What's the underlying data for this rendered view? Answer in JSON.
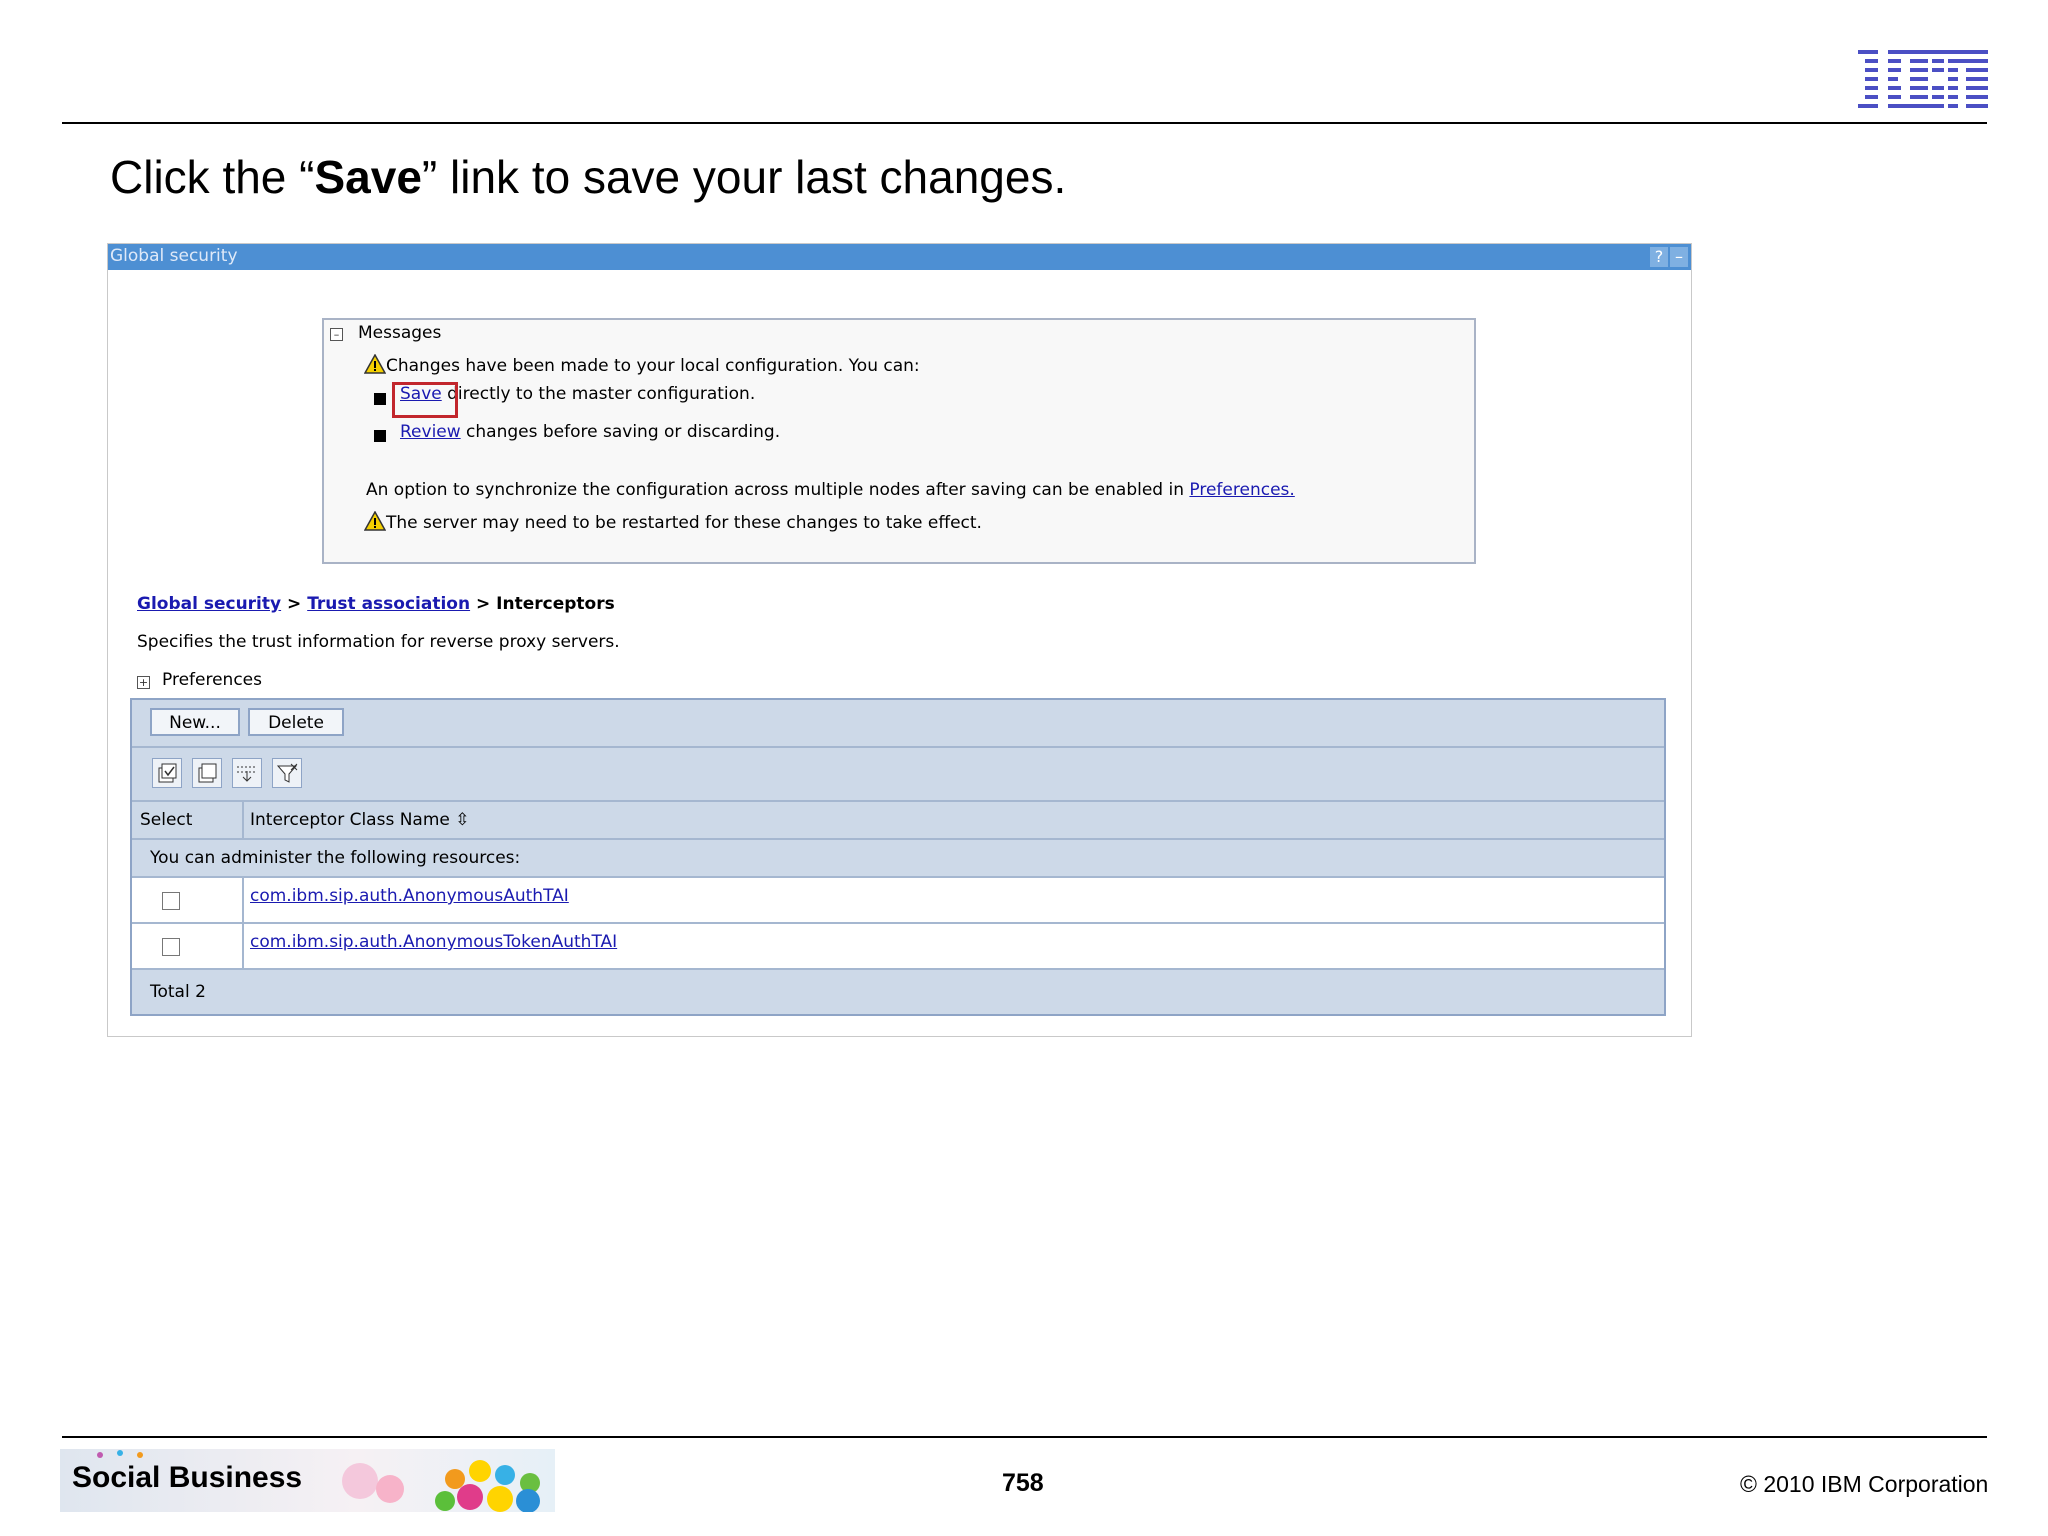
{
  "slide": {
    "title_prefix": "Click the “",
    "title_bold": "Save",
    "title_suffix": "” link to save your last changes.",
    "logo_text": "IBM"
  },
  "window": {
    "title": "Global security",
    "help_icon": "?",
    "minimize_icon": "–"
  },
  "messages": {
    "header": "Messages",
    "changes_note": "Changes have been made to your local configuration. You can:",
    "save_link": "Save",
    "save_rest": " directly to the master configuration.",
    "review_link": "Review",
    "review_rest": " changes before saving or discarding.",
    "sync_note": "An option to synchronize the configuration across multiple nodes after saving can be enabled in ",
    "preferences_link": "Preferences.",
    "restart_note": "The server may need to be restarted for these changes to take effect."
  },
  "breadcrumb": {
    "item1": "Global security",
    "sep": " > ",
    "item2": "Trust association",
    "current": "Interceptors"
  },
  "description": "Specifies the trust information for reverse proxy servers.",
  "preferences_toggle": "Preferences",
  "toolbar": {
    "new_label": "New...",
    "delete_label": "Delete"
  },
  "table": {
    "col_select": "Select",
    "col_name": "Interceptor Class Name",
    "resources_note": "You can administer the following resources:",
    "rows": [
      "com.ibm.sip.auth.AnonymousAuthTAI",
      "com.ibm.sip.auth.AnonymousTokenAuthTAI"
    ],
    "total": "Total 2"
  },
  "footer": {
    "brand": "Social Business",
    "page_number": "758",
    "copyright": "© 2010 IBM Corporation"
  }
}
